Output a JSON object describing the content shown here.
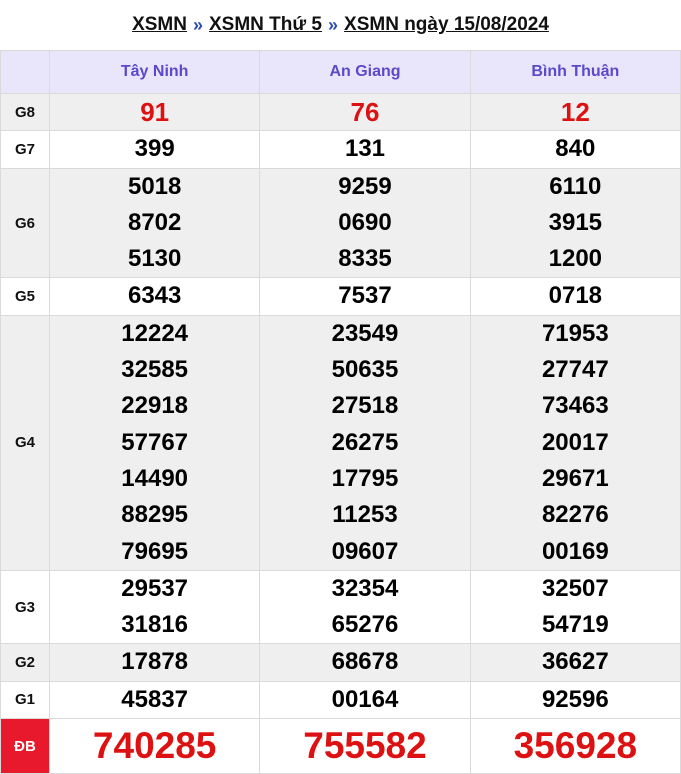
{
  "breadcrumb": {
    "items": [
      "XSMN",
      "XSMN Thứ 5",
      "XSMN ngày 15/08/2024"
    ],
    "separator": "»"
  },
  "provinces": [
    "Tây Ninh",
    "An Giang",
    "Bình Thuận"
  ],
  "prizes": [
    {
      "label": "G8",
      "values": [
        [
          "91"
        ],
        [
          "76"
        ],
        [
          "12"
        ]
      ]
    },
    {
      "label": "G7",
      "values": [
        [
          "399"
        ],
        [
          "131"
        ],
        [
          "840"
        ]
      ]
    },
    {
      "label": "G6",
      "values": [
        [
          "5018",
          "8702",
          "5130"
        ],
        [
          "9259",
          "0690",
          "8335"
        ],
        [
          "6110",
          "3915",
          "1200"
        ]
      ]
    },
    {
      "label": "G5",
      "values": [
        [
          "6343"
        ],
        [
          "7537"
        ],
        [
          "0718"
        ]
      ]
    },
    {
      "label": "G4",
      "values": [
        [
          "12224",
          "32585",
          "22918",
          "57767",
          "14490",
          "88295",
          "79695"
        ],
        [
          "23549",
          "50635",
          "27518",
          "26275",
          "17795",
          "11253",
          "09607"
        ],
        [
          "71953",
          "27747",
          "73463",
          "20017",
          "29671",
          "82276",
          "00169"
        ]
      ]
    },
    {
      "label": "G3",
      "values": [
        [
          "29537",
          "31816"
        ],
        [
          "32354",
          "65276"
        ],
        [
          "32507",
          "54719"
        ]
      ]
    },
    {
      "label": "G2",
      "values": [
        [
          "17878"
        ],
        [
          "68678"
        ],
        [
          "36627"
        ]
      ]
    },
    {
      "label": "G1",
      "values": [
        [
          "45837"
        ],
        [
          "00164"
        ],
        [
          "92596"
        ]
      ]
    },
    {
      "label": "ĐB",
      "values": [
        [
          "740285"
        ],
        [
          "755582"
        ],
        [
          "356928"
        ]
      ]
    }
  ],
  "colors": {
    "header_bg": "#e9e6fb",
    "header_text": "#5b49c9",
    "highlight_red": "#dd1111",
    "special_label_bg": "#e8192c"
  }
}
